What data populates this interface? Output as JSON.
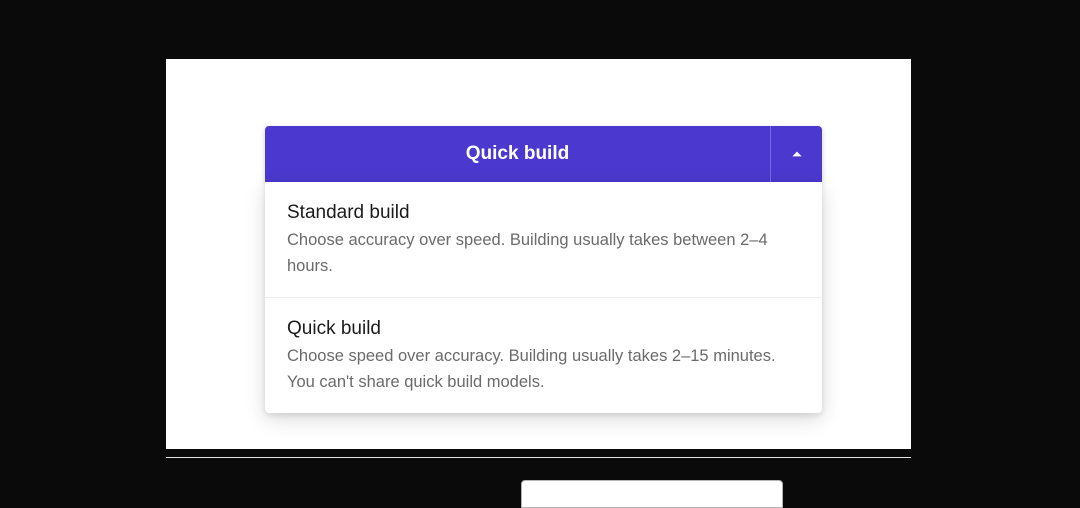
{
  "dropdown": {
    "selected_label": "Quick build",
    "caret_icon": "chevron-up-icon",
    "options": [
      {
        "title": "Standard build",
        "description": "Choose accuracy over speed. Building usually takes between 2–4 hours."
      },
      {
        "title": "Quick build",
        "description": "Choose speed over accuracy. Building usually takes 2–15 minutes. You can't share quick build models."
      }
    ]
  },
  "colors": {
    "primary": "#4b39cf",
    "panel_bg": "#ffffff",
    "page_bg": "#0a0a0a",
    "text_primary": "#1b1b1b",
    "text_secondary": "#6b6b6b"
  }
}
